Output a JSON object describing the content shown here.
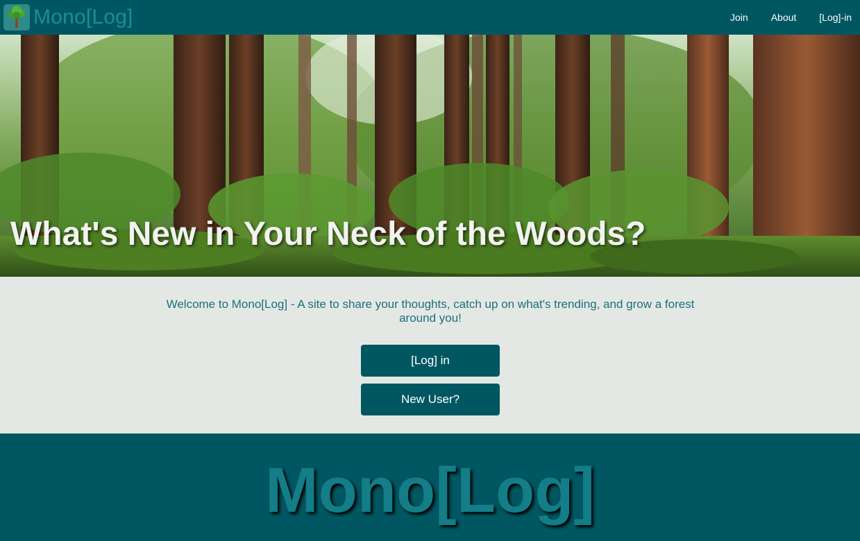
{
  "header": {
    "brand": "Mono[Log]",
    "nav": [
      {
        "label": "Join"
      },
      {
        "label": "About"
      },
      {
        "label": "[Log]-in"
      }
    ]
  },
  "hero": {
    "title": "What's New in Your Neck of the Woods?"
  },
  "welcome": {
    "text": "Welcome to Mono[Log] - A site to share your thoughts, catch up on what's trending, and grow a forest around you!",
    "login_button": "[Log] in",
    "new_user_button": "New User?"
  },
  "footer": {
    "brand": "Mono[Log]"
  },
  "colors": {
    "primary": "#005761",
    "brand_text": "#1d8d96",
    "welcome_text": "#1a6f7c",
    "background": "#e4e8e5"
  }
}
